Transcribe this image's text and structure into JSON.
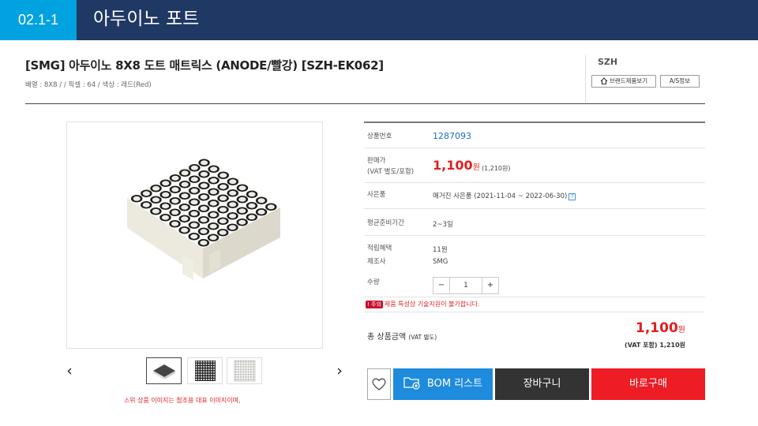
{
  "slide": {
    "number": "02.1-1",
    "title": "아두이노 포트"
  },
  "product": {
    "title": "[SMG] 아두이노 8X8 도트 매트릭스 (ANODE/빨강) [SZH-EK062]",
    "spec": "배열 : 8X8 / / 픽셀 : 64 / 색상 : 레드(Red)",
    "brand": "SZH",
    "brand_button": "브랜드제품보기",
    "as_button": "A/S정보"
  },
  "gallery": {
    "prev": "‹",
    "next": "›",
    "note": "위 상품 이미지는 참조용 대표 이미지이며,"
  },
  "info": {
    "code_label": "상품번호",
    "code": "1287093",
    "price_label_1": "판매가",
    "price_label_2": "(VAT 별도/포함)",
    "price": "1,100",
    "price_unit": "원",
    "price_vat": "(1,210원)",
    "used_label": "사은품",
    "used_value": "매거진 사은품 (2021-11-04 ~ 2022-06-30)",
    "help": "?",
    "prep_label": "평균준비기간",
    "prep_value": "2~3일",
    "points_label": "적립혜택",
    "points_value": "11원",
    "maker_label": "제조사",
    "maker_value": "SMG",
    "qty_label": "수량",
    "qty_minus": "−",
    "qty_value": "1",
    "qty_plus": "+",
    "warn_tag": "! 주의",
    "warn_text": "제품 특성상 기술지원이 불가합니다."
  },
  "total": {
    "label": "총 상품금액",
    "label_sub": "(VAT 별도)",
    "amount": "1,100",
    "unit": "원",
    "vat": "(VAT 포함) 1,210원"
  },
  "buttons": {
    "bom": "BOM 리스트",
    "cart": "장바구니",
    "buy": "바로구매"
  },
  "icons": [
    "home-icon",
    "heart-icon",
    "folder-add-icon"
  ],
  "colors": {
    "header": "#1f3864",
    "accent": "#00a3e0",
    "price": "#e02020",
    "bom": "#1e8bdd",
    "cart": "#333333",
    "buy": "#ee1c25"
  }
}
